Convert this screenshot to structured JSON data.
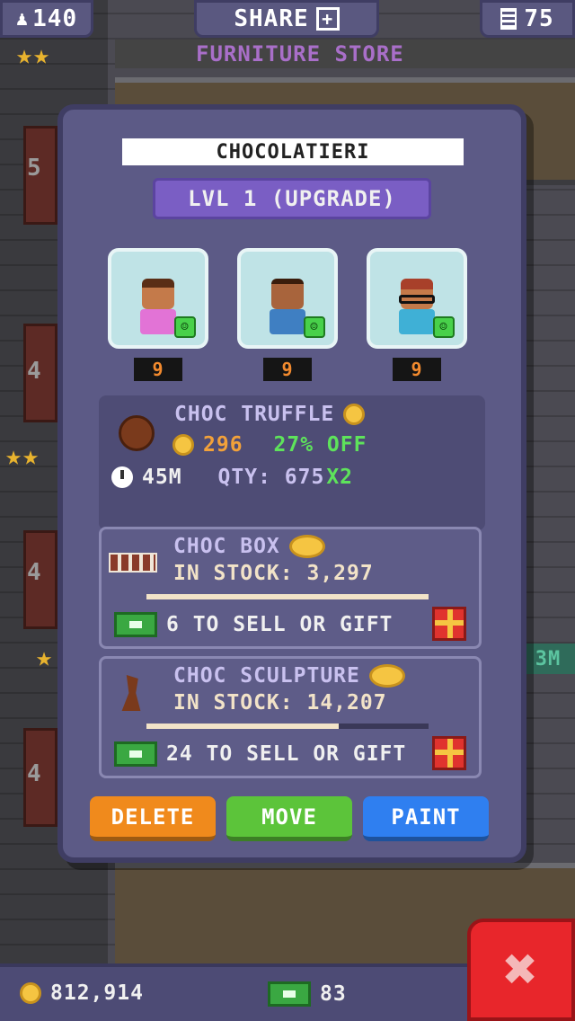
{
  "topbar": {
    "population": "140",
    "share_label": "SHARE",
    "floors": "75"
  },
  "store_label": "FURNITURE STORE",
  "background": {
    "floor_numbers": [
      "5",
      "4",
      "4",
      "4"
    ],
    "right_timer": "3M"
  },
  "panel": {
    "business_name": "CHOCOLATIERI",
    "level_button": "LVL 1 (UPGRADE)",
    "residents": [
      {
        "level": "9",
        "skin": "#c47a4a",
        "shirt": "#e273d6"
      },
      {
        "level": "9",
        "skin": "#a8643c",
        "shirt": "#3f7fc2"
      },
      {
        "level": "9",
        "skin": "#c47a4a",
        "shirt": "#3fb0d6"
      }
    ],
    "current_product": {
      "name": "CHOC TRUFFLE",
      "cost": "296",
      "discount": "27% OFF",
      "time": "45M",
      "qty_label": "QTY: 675",
      "multiplier": "X2"
    },
    "stock_items": [
      {
        "name": "CHOC BOX",
        "stock_label": "IN STOCK: 3,297",
        "stock_fraction": 1.0,
        "sell_label": "6 TO SELL OR GIFT"
      },
      {
        "name": "CHOC SCULPTURE",
        "stock_label": "IN STOCK: 14,207",
        "stock_fraction": 0.68,
        "sell_label": "24 TO SELL OR GIFT"
      }
    ],
    "actions": {
      "delete_label": "DELETE",
      "move_label": "MOVE",
      "paint_label": "PAINT"
    }
  },
  "bottom_bar": {
    "coins": "812,914",
    "bux": "83"
  },
  "colors": {
    "delete": "#f08a1c",
    "move": "#5cc43a",
    "paint": "#2f7ff0",
    "close": "#e8262b"
  },
  "icons": {
    "population": "person-icon",
    "share": "plus-square-icon",
    "floors": "building-icon",
    "close": "x-icon"
  }
}
